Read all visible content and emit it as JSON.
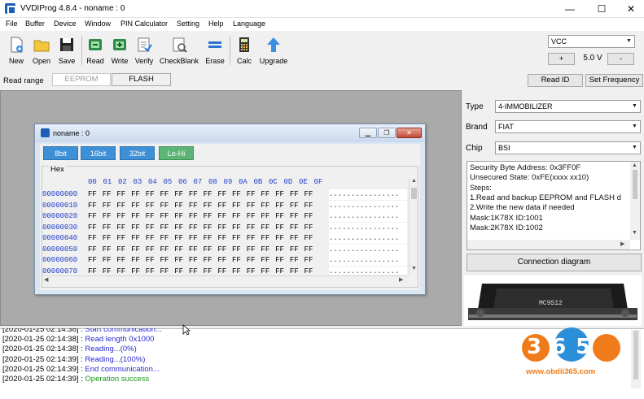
{
  "window": {
    "title": "VVDIProg 4.8.4 - noname : 0",
    "minimize": "—",
    "maximize": "☐",
    "close": "✕"
  },
  "menu": [
    "File",
    "Buffer",
    "Device",
    "Window",
    "PIN Calculator",
    "Setting",
    "Help",
    "Language"
  ],
  "toolbar": {
    "new": "New",
    "open": "Open",
    "save": "Save",
    "read": "Read",
    "write": "Write",
    "verify": "Verify",
    "checkblank": "CheckBlank",
    "erase": "Erase",
    "calc": "Calc",
    "upgrade": "Upgrade",
    "vcc": "VCC",
    "plus": "+",
    "voltage": "5.0 V",
    "minus": "-"
  },
  "read_range": {
    "label": "Read range",
    "eeprom": "EEPROM",
    "flash": "FLASH",
    "read_id": "Read ID",
    "set_frequency": "Set Frequency"
  },
  "child": {
    "title": "noname : 0",
    "bits": [
      "8bit",
      "16bit",
      "32bit",
      "Lo-Hi"
    ],
    "group": "Hex",
    "header": [
      "00",
      "01",
      "02",
      "03",
      "04",
      "05",
      "06",
      "07",
      "08",
      "09",
      "0A",
      "0B",
      "0C",
      "0D",
      "0E",
      "0F"
    ],
    "addresses": [
      "00000000",
      "00000010",
      "00000020",
      "00000030",
      "00000040",
      "00000050",
      "00000060",
      "00000070"
    ],
    "row_data": "FF FF FF FF FF FF FF FF FF FF FF FF FF FF FF FF",
    "ascii": "................"
  },
  "device": {
    "type_label": "Type",
    "type_value": "4-IMMOBILIZER",
    "brand_label": "Brand",
    "brand_value": "FIAT",
    "chip_label": "Chip",
    "chip_value": "BSI",
    "info": [
      "Security Byte Address: 0x3FF0F",
      "Unsecured State: 0xFE(xxxx xx10)",
      "Steps:",
      "1.Read and backup EEPROM and FLASH d",
      "2.Write the new data if needed",
      "Mask:1K78X ID:1001",
      "Mask:2K78X ID:1002"
    ],
    "connection_button": "Connection diagram",
    "chip_marking": "MC9S12"
  },
  "log": [
    {
      "ts": "[2020-01-25 02:14:38] :",
      "msg": "Start communication...",
      "kind": "info"
    },
    {
      "ts": "[2020-01-25 02:14:38] :",
      "msg": "Read length 0x1000",
      "kind": "info"
    },
    {
      "ts": "[2020-01-25 02:14:38] :",
      "msg": "Reading...(0%)",
      "kind": "info"
    },
    {
      "ts": "[2020-01-25 02:14:39] :",
      "msg": "Reading...(100%)",
      "kind": "info"
    },
    {
      "ts": "[2020-01-25 02:14:39] :",
      "msg": "End communication...",
      "kind": "info"
    },
    {
      "ts": "[2020-01-25 02:14:39] :",
      "msg": "Operation success",
      "kind": "ok"
    }
  ],
  "watermark": {
    "brand": "365",
    "url": "www.obdii365.com"
  }
}
